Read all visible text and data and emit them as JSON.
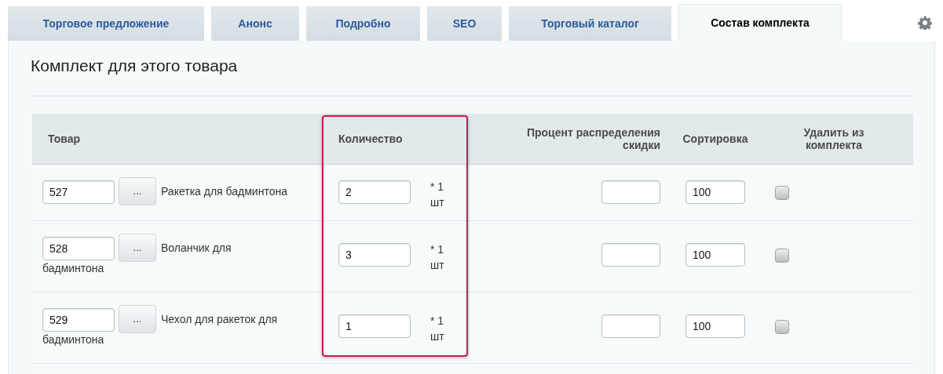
{
  "tabs": [
    {
      "label": "Торговое предложение",
      "selected": false
    },
    {
      "label": "Анонс",
      "selected": false
    },
    {
      "label": "Подробно",
      "selected": false
    },
    {
      "label": "SEO",
      "selected": false
    },
    {
      "label": "Торговый каталог",
      "selected": false
    },
    {
      "label": "Состав комплекта",
      "selected": true
    }
  ],
  "section_title": "Комплект для этого товара",
  "table": {
    "columns": [
      "Товар",
      "Количество",
      "Процент распределения скидки",
      "Сортировка",
      "Удалить из комплекта"
    ],
    "rows": [
      {
        "product_id": "527",
        "browse_button": "...",
        "product_name_lines": [
          "Ракетка для бадминтона"
        ],
        "quantity": "2",
        "unit": "* 1 шт",
        "sort": "100",
        "delete": false
      },
      {
        "product_id": "528",
        "browse_button": "...",
        "product_name_lines": [
          "Воланчик для",
          "бадминтона"
        ],
        "quantity": "3",
        "unit": "* 1 шт",
        "sort": "100",
        "delete": false
      },
      {
        "product_id": "529",
        "browse_button": "...",
        "product_name_lines": [
          "Чехол для ракеток для",
          "бадминтона"
        ],
        "quantity": "1",
        "unit": "* 1 шт",
        "sort": "100",
        "delete": false
      }
    ]
  }
}
